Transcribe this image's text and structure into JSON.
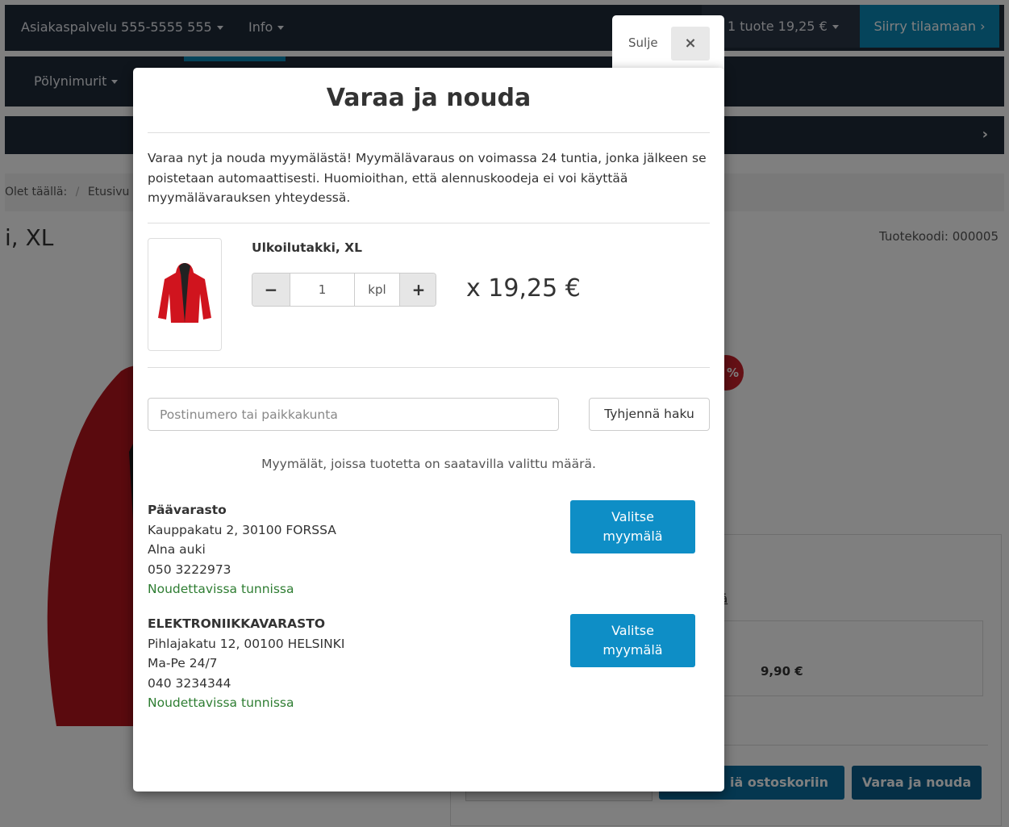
{
  "header": {
    "customer_service": "Asiakaspalvelu 555-5555 555",
    "info": "Info",
    "cart_summary": "1 tuote  19,25 €",
    "checkout": "Siirry tilaamaan ›"
  },
  "nav": {
    "category": "Pölynimurit"
  },
  "breadcrumb": {
    "prefix": "Olet täällä:",
    "sep": "/",
    "home": "Etusivu"
  },
  "product_page": {
    "title_fragment": "i, XL",
    "code": "Tuotekoodi: 000005",
    "discount_fragment": "%",
    "link_fragment": "ä",
    "shipping_price": "9,90 €",
    "add_to_cart_fragment": "iä ostoskoriin",
    "reserve_button": "Varaa ja nouda"
  },
  "modal": {
    "close_label": "Sulje",
    "close_icon": "×",
    "title": "Varaa ja nouda",
    "intro": "Varaa nyt ja nouda myymälästä! Myymälävaraus on voimassa 24 tuntia, jonka jälkeen se poistetaan automaattisesti. Huomioithan, että alennuskoodeja ei voi käyttää myymälävarauksen yhteydessä.",
    "product_name": "Ulkoilutakki, XL",
    "quantity": "1",
    "unit": "kpl",
    "minus": "−",
    "plus": "+",
    "price": "x  19,25 €",
    "search_placeholder": "Postinumero tai paikkakunta",
    "search_value": "",
    "clear_button": "Tyhjennä haku",
    "note": "Myymälät, joissa tuotetta on saatavilla valittu määrä.",
    "select_button_line1": "Valitse",
    "select_button_line2": "myymälä",
    "stores": [
      {
        "name": "Päävarasto",
        "address": "Kauppakatu 2, 30100 FORSSA",
        "hours": "Alna auki",
        "phone": "050 3222973",
        "availability": "Noudettavissa tunnissa"
      },
      {
        "name": "ELEKTRONIIKKAVARASTO",
        "address": "Pihlajakatu 12, 00100 HELSINKI",
        "hours": "Ma-Pe 24/7",
        "phone": "040 3234344",
        "availability": "Noudettavissa tunnissa"
      }
    ]
  },
  "colors": {
    "nav_bg": "#1f2a38",
    "accent": "#0b88b6",
    "button": "#0e8ec6",
    "available": "#2e7d32",
    "badge": "#c8202b"
  }
}
